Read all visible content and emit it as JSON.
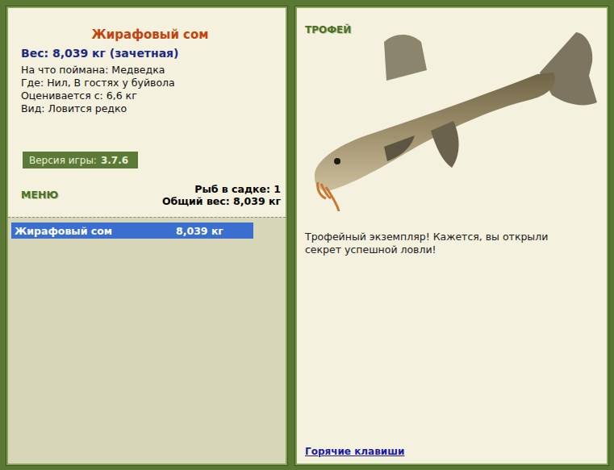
{
  "fish": {
    "name": "Жирафовый сом",
    "weight_label": "Вес: 8,039 кг (зачетная)",
    "details": [
      "На что поймана: Медведка",
      "Где: Нил, В гостях у буйвола",
      "Оценивается с: 6,6 кг",
      "Вид: Ловится редко"
    ]
  },
  "version": {
    "label": "Версия игры:",
    "value": "3.7.6"
  },
  "menu": "МЕНЮ",
  "summary": [
    "Рыб в садке: 1",
    "Общий вес: 8,039 кг"
  ],
  "keepnet": [
    {
      "name": "Жирафовый сом",
      "weight": "8,039 кг",
      "selected": true
    }
  ],
  "trophy": {
    "badge": "ТРОФЕЙ",
    "message": "Трофейный экземпляр! Кажется, вы открыли секрет успешной ловли!"
  },
  "hotkeys": "Горячие клавиши"
}
